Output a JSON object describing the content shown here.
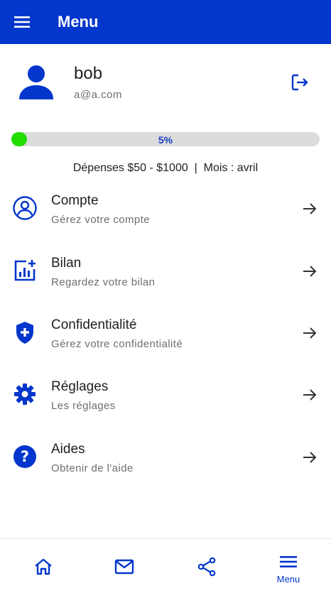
{
  "appbar": {
    "title": "Menu",
    "menu_icon": "hamburger-icon"
  },
  "profile": {
    "name": "bob",
    "email": "a@a.com",
    "avatar_icon": "person-icon",
    "logout_icon": "logout-icon"
  },
  "progress": {
    "label": "5%",
    "value": 0.05
  },
  "summary": "Dépenses $50 - $1000  |  Mois : avril",
  "menu": [
    {
      "title": "Compte",
      "subtitle": "Gérez votre compte",
      "icon": "account-circle-icon"
    },
    {
      "title": "Bilan",
      "subtitle": "Regardez votre bilan",
      "icon": "chart-add-icon"
    },
    {
      "title": "Confidentialité",
      "subtitle": "Gérez votre confidentialité",
      "icon": "shield-plus-icon"
    },
    {
      "title": "Réglages",
      "subtitle": "Les réglages",
      "icon": "gear-icon"
    },
    {
      "title": "Aides",
      "subtitle": "Obtenir de l'aide",
      "icon": "help-circle-icon"
    }
  ],
  "bottom_nav": [
    {
      "icon": "home-icon"
    },
    {
      "icon": "mail-icon"
    },
    {
      "icon": "share-icon"
    },
    {
      "icon": "hamburger-icon",
      "label": "Menu"
    }
  ],
  "colors": {
    "primary": "#0236cc",
    "progress_fill": "#22dd00",
    "progress_track": "#dcdcdc"
  }
}
